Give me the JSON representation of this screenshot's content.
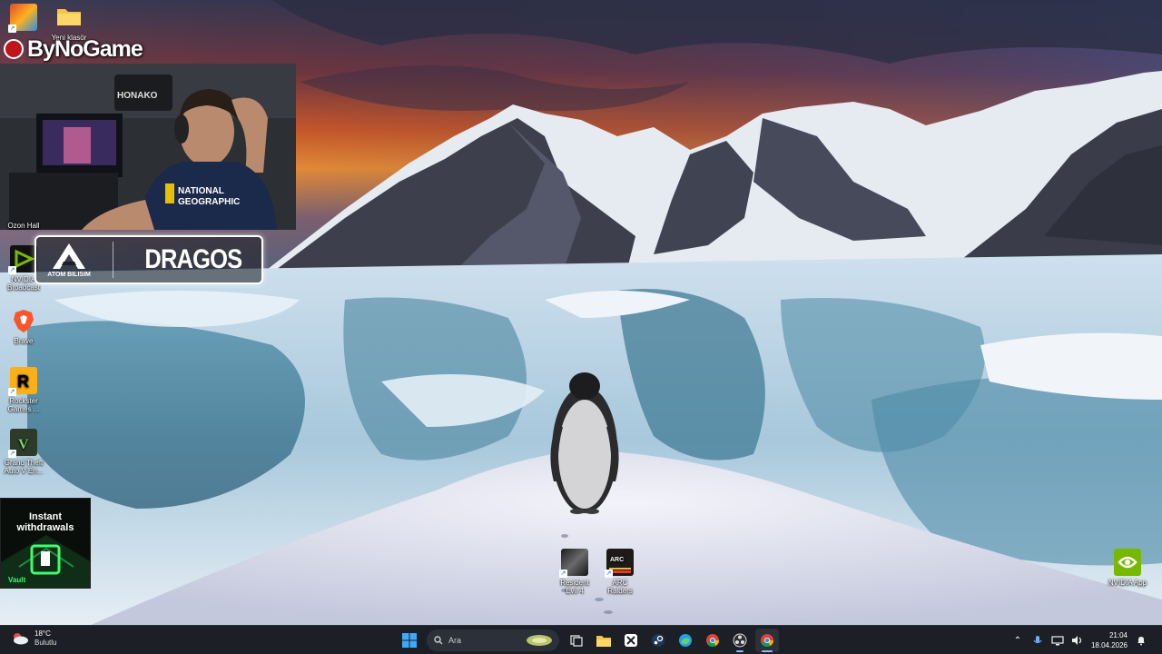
{
  "desktop": {
    "left_icons": [
      {
        "label": "",
        "icon": "app-shortcut-icon"
      },
      {
        "label": "Yeni klasör",
        "icon": "folder-icon"
      },
      {
        "label": "Ozon Hall",
        "icon": "app-shortcut-icon"
      },
      {
        "label": "NVIDIA Broadcast",
        "icon": "nvidia-broadcast-icon"
      },
      {
        "label": "Brave",
        "icon": "brave-browser-icon"
      },
      {
        "label": "Rockster Games ...",
        "icon": "rockstar-games-icon"
      },
      {
        "label": "Grand Theft Auto V En...",
        "icon": "gta-v-icon"
      }
    ],
    "bottom_icons": [
      {
        "label": "Resident Evil 4",
        "icon": "resident-evil-4-icon"
      },
      {
        "label": "ARC Raiders",
        "icon": "arc-raiders-icon"
      },
      {
        "label": "NVIDIA App",
        "icon": "nvidia-app-icon"
      }
    ]
  },
  "overlay": {
    "brand": "ByNoGame",
    "webcam_shirt_line1": "NATIONAL",
    "webcam_shirt_line2": "GEOGRAPHIC",
    "webcam_sign": "HONAKO",
    "sponsor_left": "ATOM BILISIM",
    "sponsor_right": "DRAGOS",
    "promo_title_line1": "Instant",
    "promo_title_line2": "withdrawals",
    "promo_brand": "Vault"
  },
  "taskbar": {
    "weather_temp": "18°C",
    "weather_desc": "Bulutlu",
    "search_placeholder": "Ara",
    "time": "21:04",
    "date": "18.04.2026",
    "pinned": [
      "start-icon",
      "search-icon",
      "task-view-icon",
      "file-explorer-icon",
      "xbox-icon",
      "steam-icon",
      "edge-icon",
      "chrome-icon",
      "obs-icon",
      "chrome-profile-icon"
    ]
  },
  "colors": {
    "taskbar_bg": "#1c1f26",
    "sky_orange": "#ff7a2a",
    "ice_blue": "#7fb8cf",
    "accent_blue": "#3a8ee6"
  }
}
